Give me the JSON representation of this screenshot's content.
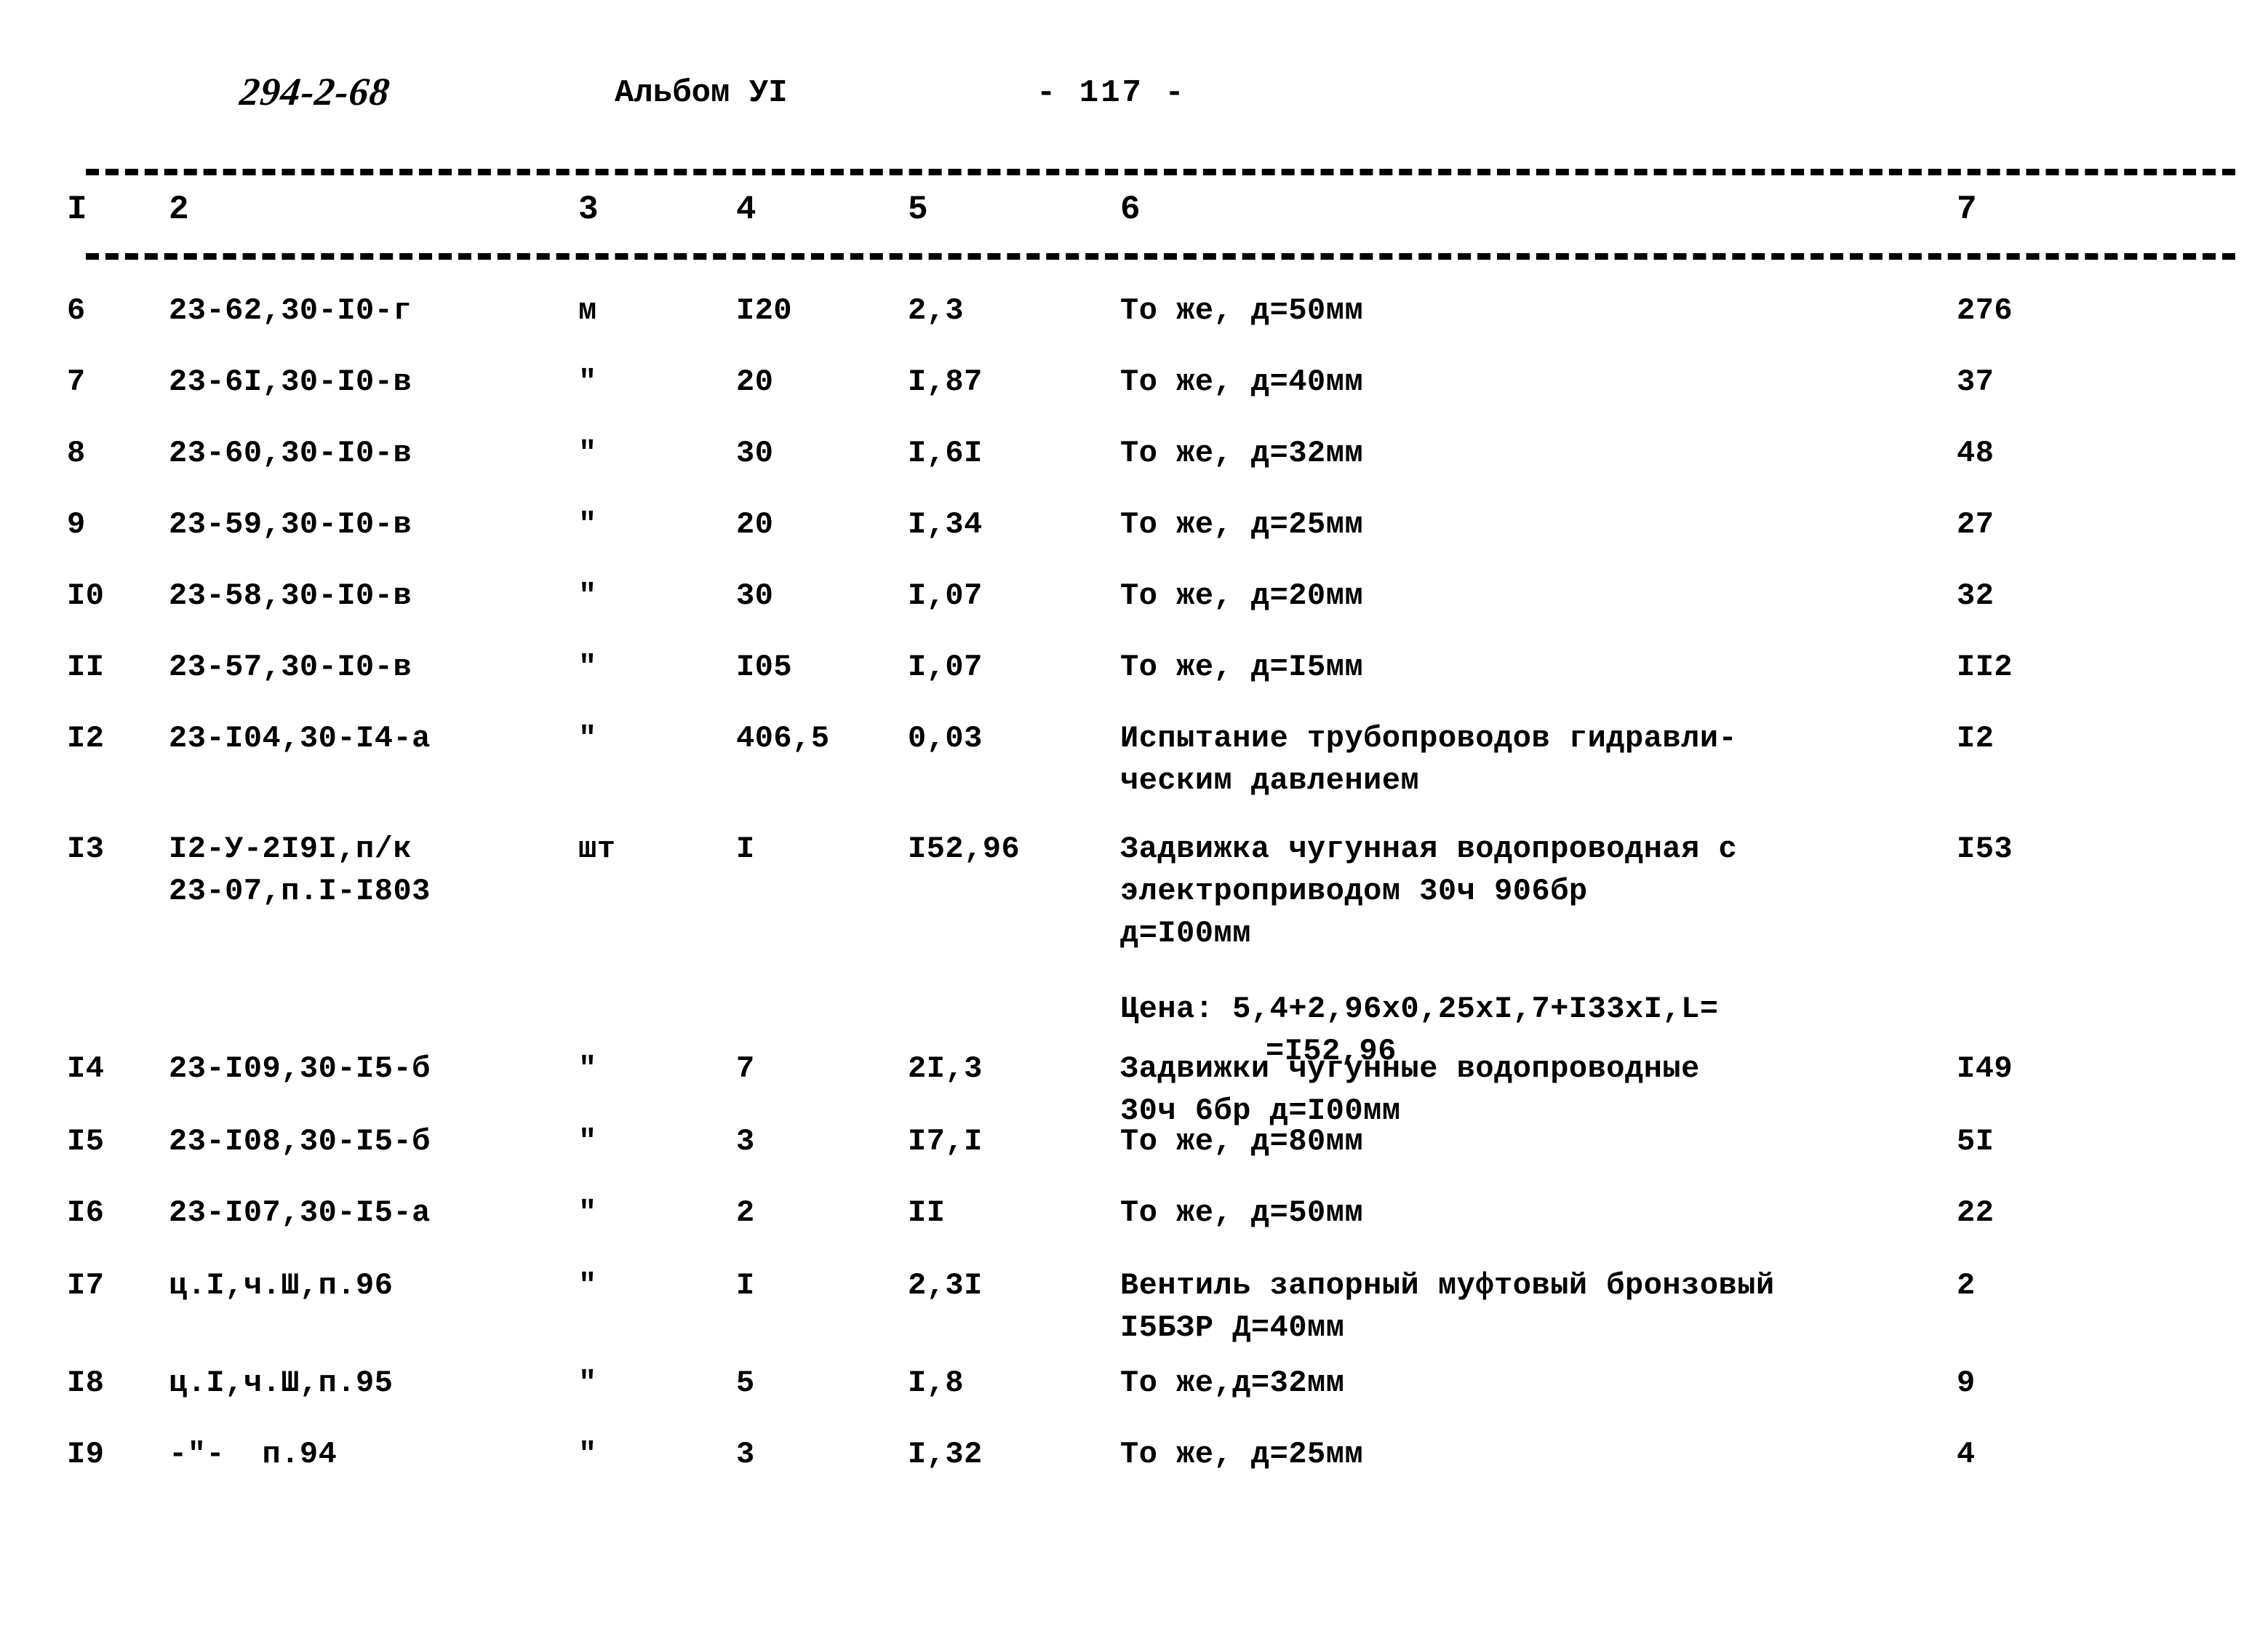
{
  "header": {
    "doc_code": "294-2-68",
    "album": "Альбом УI",
    "page_number": "- 117 -"
  },
  "table": {
    "column_headers": [
      "I",
      "2",
      "3",
      "4",
      "5",
      "6",
      "7"
    ],
    "rows": [
      {
        "c1": "6",
        "c2": "23-62,30-I0-г",
        "c3": "м",
        "c4": "I20",
        "c5": "2,3",
        "c6": "То же, д=50мм",
        "c7": "276"
      },
      {
        "c1": "7",
        "c2": "23-6I,30-I0-в",
        "c3": "\"",
        "c4": "20",
        "c5": "I,87",
        "c6": "То же, д=40мм",
        "c7": "37"
      },
      {
        "c1": "8",
        "c2": "23-60,30-I0-в",
        "c3": "\"",
        "c4": "30",
        "c5": "I,6I",
        "c6": "То же, д=32мм",
        "c7": "48"
      },
      {
        "c1": "9",
        "c2": "23-59,30-I0-в",
        "c3": "\"",
        "c4": "20",
        "c5": "I,34",
        "c6": "То же, д=25мм",
        "c7": "27"
      },
      {
        "c1": "I0",
        "c2": "23-58,30-I0-в",
        "c3": "\"",
        "c4": "30",
        "c5": "I,07",
        "c6": "То же, д=20мм",
        "c7": "32"
      },
      {
        "c1": "II",
        "c2": "23-57,30-I0-в",
        "c3": "\"",
        "c4": "I05",
        "c5": "I,07",
        "c6": "То же, д=I5мм",
        "c7": "II2"
      },
      {
        "c1": "I2",
        "c2": "23-I04,30-I4-а",
        "c3": "\"",
        "c4": "406,5",
        "c5": "0,03",
        "c6": "Испытание трубопроводов гидравли-\nческим давлением",
        "c7": "I2"
      },
      {
        "c1": "I3",
        "c2": "I2-У-2I9I,п/к\n23-07,п.I-I803",
        "c3": "шт",
        "c4": "I",
        "c5": "I52,96",
        "c6": "Задвижка чугунная водопроводная с\nэлектроприводом 30ч 906бр\nд=I00мм",
        "c6_price_label": "Цена: 5,4+2,96х0,25хI,7+I33хI,L=",
        "c6_price_cont": "=I52,96",
        "c7": "I53"
      },
      {
        "c1": "I4",
        "c2": "23-I09,30-I5-б",
        "c3": "\"",
        "c4": "7",
        "c5": "2I,3",
        "c6": "Задвижки чугунные водопроводные\n30ч 6бр д=I00мм",
        "c7": "I49"
      },
      {
        "c1": "I5",
        "c2": "23-I08,30-I5-б",
        "c3": "\"",
        "c4": "3",
        "c5": "I7,I",
        "c6": "То же, д=80мм",
        "c7": "5I"
      },
      {
        "c1": "I6",
        "c2": "23-I07,30-I5-а",
        "c3": "\"",
        "c4": "2",
        "c5": "II",
        "c6": "То же, д=50мм",
        "c7": "22"
      },
      {
        "c1": "I7",
        "c2": "ц.I,ч.Ш,п.96",
        "c3": "\"",
        "c4": "I",
        "c5": "2,3I",
        "c6": "Вентиль запорный муфтовый бронзовый\nI5БЗР Д=40мм",
        "c7": "2"
      },
      {
        "c1": "I8",
        "c2": "ц.I,ч.Ш,п.95",
        "c3": "\"",
        "c4": "5",
        "c5": "I,8",
        "c6": "То же,д=32мм",
        "c7": "9"
      },
      {
        "c1": "I9",
        "c2": "-\"-  п.94",
        "c3": "\"",
        "c4": "3",
        "c5": "I,32",
        "c6": "То же, д=25мм",
        "c7": "4"
      }
    ]
  }
}
